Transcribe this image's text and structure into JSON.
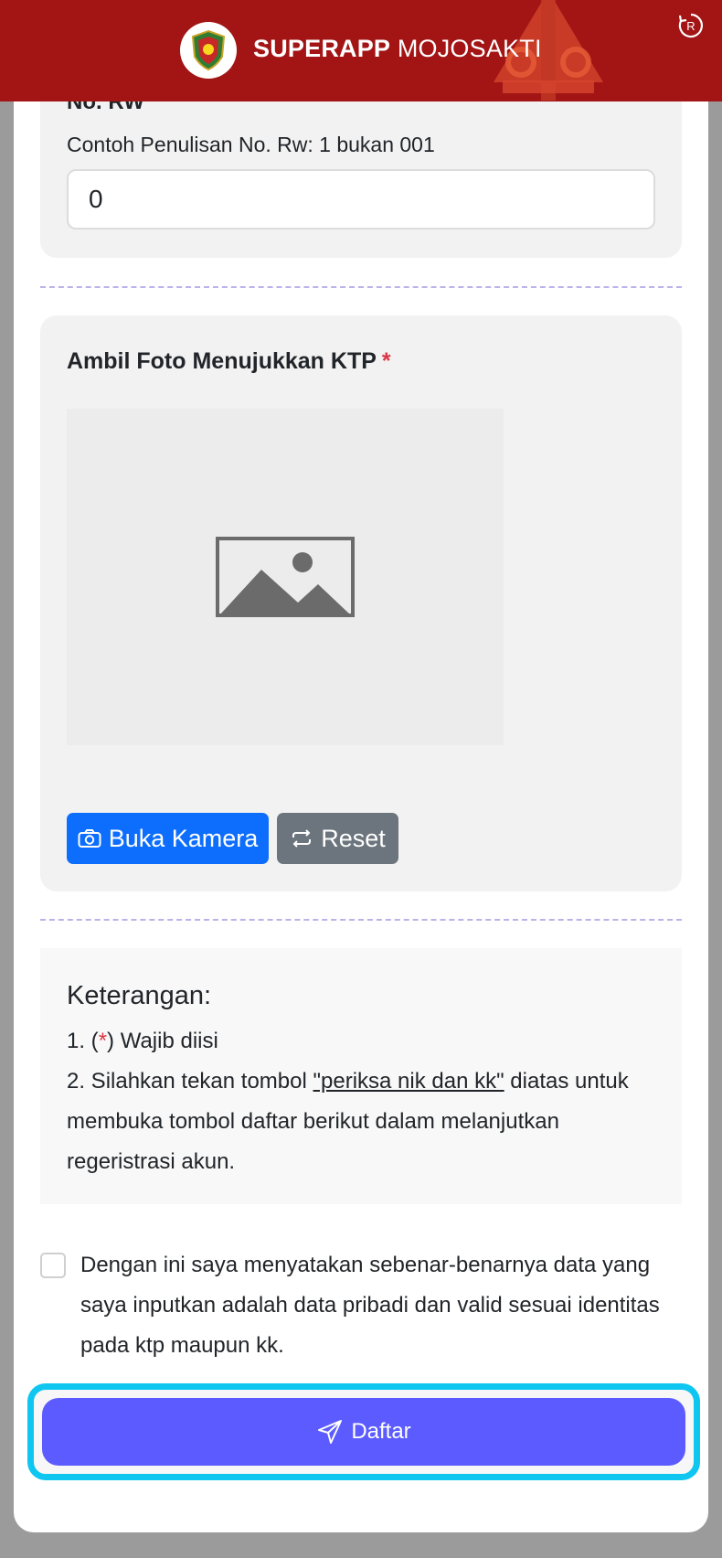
{
  "header": {
    "title_bold": "SUPERAPP",
    "title_rest": " MOJOSAKTI",
    "logo_icon": "emblem-icon",
    "reload_icon": "reload-registered-icon",
    "color": "#a31515"
  },
  "rw": {
    "label": "No. RW",
    "hint": "Contoh Penulisan No. Rw: 1 bukan 001",
    "value": "0"
  },
  "foto": {
    "label": "Ambil Foto Menujukkan KTP",
    "required_mark": "*",
    "preview_icon": "image-placeholder-icon",
    "camera_button": "Buka Kamera",
    "reset_button": "Reset",
    "camera_color": "#0d6efd",
    "reset_color": "#6c757d"
  },
  "keterangan": {
    "title": "Keterangan:",
    "item1_prefix": "1. (",
    "item1_mark": "*",
    "item1_suffix": ") Wajib diisi",
    "item2_prefix": "2. Silahkan tekan tombol ",
    "item2_link": "\"periksa nik dan kk\"",
    "item2_suffix": " diatas untuk membuka tombol daftar berikut dalam melanjutkan regeristrasi akun."
  },
  "agreement": {
    "text": "Dengan ini saya menyatakan sebenar-benarnya data yang saya inputkan adalah data pribadi dan valid sesuai identitas pada ktp maupun kk.",
    "checked": false
  },
  "submit": {
    "label": "Daftar",
    "icon": "send-icon",
    "color": "#5b5bff",
    "highlight_color": "#0fc6f0"
  }
}
